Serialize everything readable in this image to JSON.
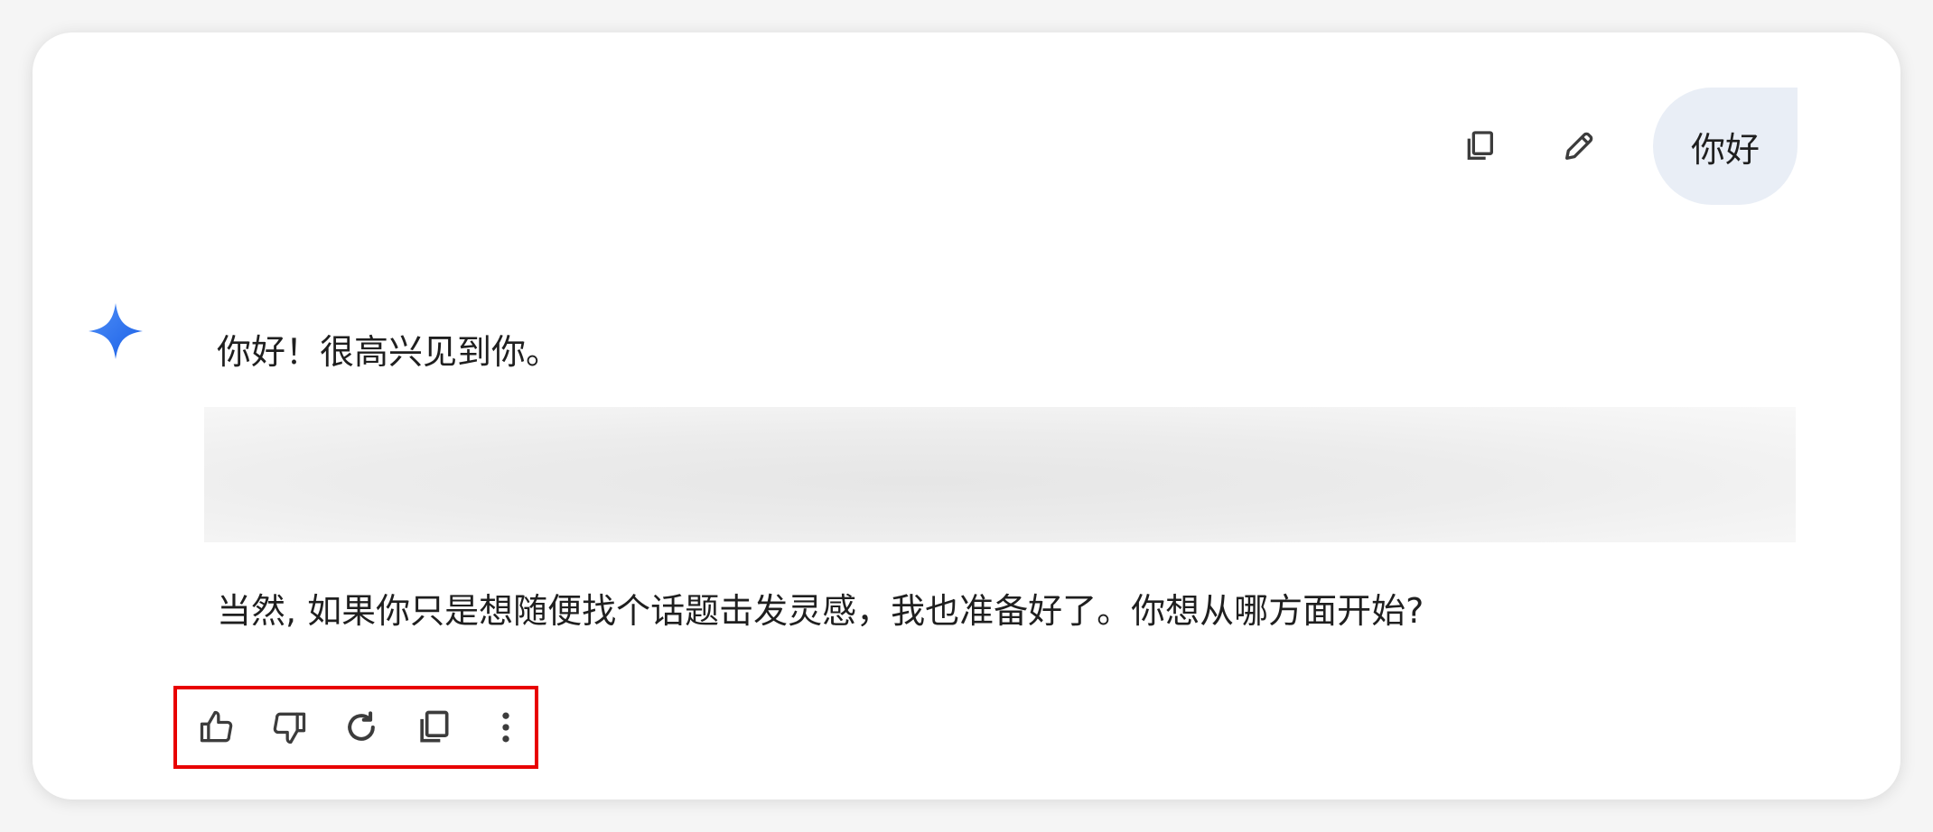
{
  "user_message": {
    "text": "你好",
    "actions": [
      {
        "name": "copy-icon"
      },
      {
        "name": "edit-pencil-icon"
      }
    ]
  },
  "assistant": {
    "avatar_icon": "gemini-sparkle-icon",
    "greeting": "你好！很高兴见到你。",
    "followup": "当然, 如果你只是想随便找个话题击发灵感，我也准备好了。你想从哪方面开始?",
    "actions": [
      {
        "name": "thumbs-up-icon"
      },
      {
        "name": "thumbs-down-icon"
      },
      {
        "name": "regenerate-icon"
      },
      {
        "name": "copy-icon"
      },
      {
        "name": "more-vertical-icon"
      }
    ]
  },
  "colors": {
    "bubble_bg": "#e9eef6",
    "highlight_border": "#e80000",
    "gem_start": "#4285f4",
    "gem_end": "#1a5fe6"
  }
}
